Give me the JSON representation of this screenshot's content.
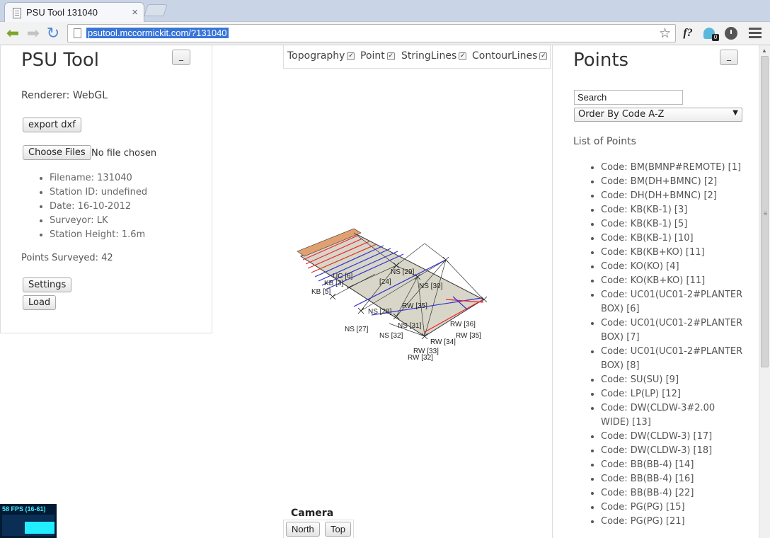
{
  "browser": {
    "tab_title": "PSU Tool 131040",
    "tab_close": "×",
    "url": "psutool.mccormickit.com/?131040",
    "extension_badge": "0"
  },
  "left_panel": {
    "title": "PSU Tool",
    "minimize_label": "_",
    "renderer": "Renderer: WebGL",
    "export_button": "export dxf",
    "choose_files_button": "Choose Files",
    "file_status": "No file chosen",
    "info": [
      "Filename: 131040",
      "Station ID: undefined",
      "Date: 16-10-2012",
      "Surveyor: LK",
      "Station Height: 1.6m"
    ],
    "points_surveyed": "Points Surveyed: 42",
    "settings_button": "Settings",
    "load_button": "Load"
  },
  "layers": [
    {
      "label": "Topography",
      "checked": true
    },
    {
      "label": "Point",
      "checked": true
    },
    {
      "label": "StringLines",
      "checked": true
    },
    {
      "label": "ContourLines",
      "checked": true
    }
  ],
  "viewport_labels": [
    "KB [3]",
    "KB [5]",
    "UC [6]",
    "[24]",
    "NS [29]",
    "NS [30]",
    "NS [28]",
    "NS [31]",
    "NS [27]",
    "NS [32]",
    "RW [36]",
    "RW [35]",
    "RW [34]",
    "RW [33]",
    "RW [32]",
    "RW [35]"
  ],
  "camera": {
    "title": "Camera",
    "north_button": "North",
    "top_button": "Top"
  },
  "fps": {
    "text": "58 FPS (16-61)"
  },
  "right_panel": {
    "title": "Points",
    "minimize_label": "_",
    "search_value": "Search",
    "order_select": "Order By Code A-Z",
    "list_title": "List of Points",
    "points": [
      "Code: BM(BMNP#REMOTE) [1]",
      "Code: BM(DH+BMNC) [2]",
      "Code: DH(DH+BMNC) [2]",
      "Code: KB(KB-1) [3]",
      "Code: KB(KB-1) [5]",
      "Code: KB(KB-1) [10]",
      "Code: KB(KB+KO) [11]",
      "Code: KO(KO) [4]",
      "Code: KO(KB+KO) [11]",
      "Code: UC01(UC01-2#PLANTER BOX) [6]",
      "Code: UC01(UC01-2#PLANTER BOX) [7]",
      "Code: UC01(UC01-2#PLANTER BOX) [8]",
      "Code: SU(SU) [9]",
      "Code: LP(LP) [12]",
      "Code: DW(CLDW-3#2.00 WIDE) [13]",
      "Code: DW(CLDW-3) [17]",
      "Code: DW(CLDW-3) [18]",
      "Code: BB(BB-4) [14]",
      "Code: BB(BB-4) [16]",
      "Code: BB(BB-4) [22]",
      "Code: PG(PG) [15]",
      "Code: PG(PG) [21]"
    ]
  }
}
